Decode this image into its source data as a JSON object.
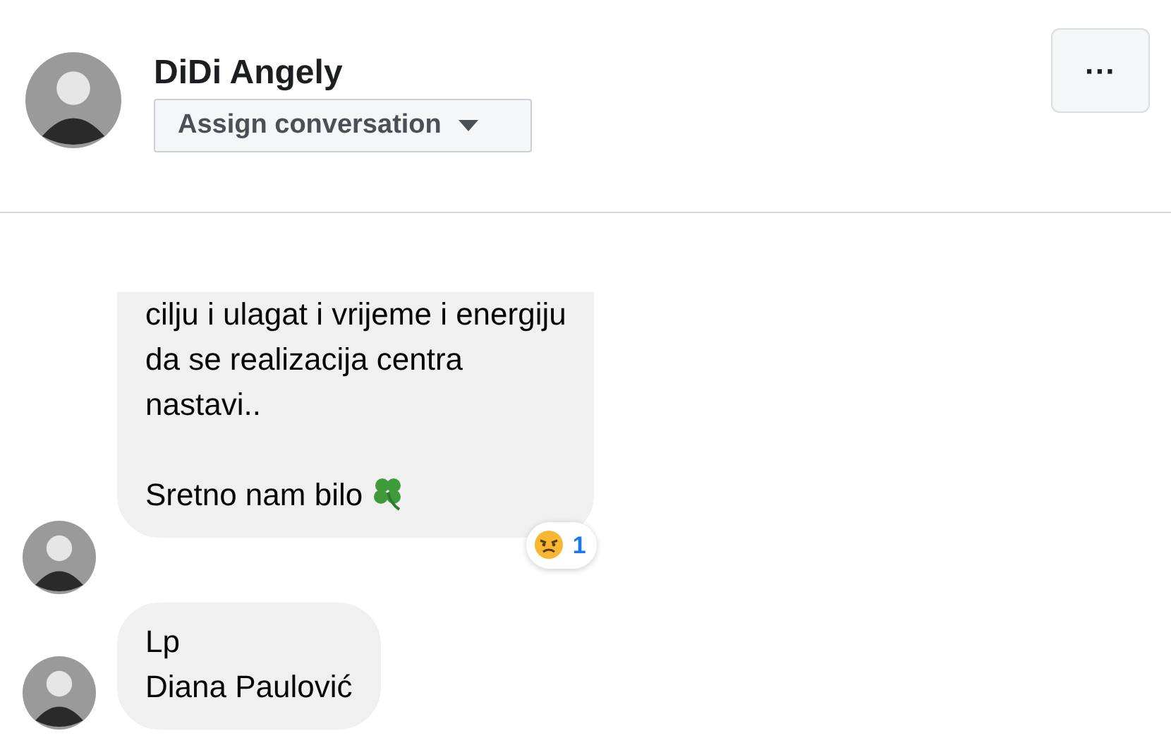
{
  "contact": {
    "name": "DiDi Angely",
    "assign_button": "Assign conversation"
  },
  "more_button": "···",
  "messages": [
    {
      "kind": "cut_off",
      "paragraphs": [
        {
          "kind": "plain",
          "text": "cilju i ulagat i vrijeme i energiju\nda se realizacija centra\nnastavi.."
        },
        {
          "kind": "clover_end",
          "text": "Sretno nam bilo"
        }
      ],
      "reaction": {
        "count": "1"
      }
    },
    {
      "kind": "whole",
      "paragraphs": [
        {
          "kind": "plain",
          "text": "Lp\nDiana Paulović"
        }
      ]
    }
  ]
}
